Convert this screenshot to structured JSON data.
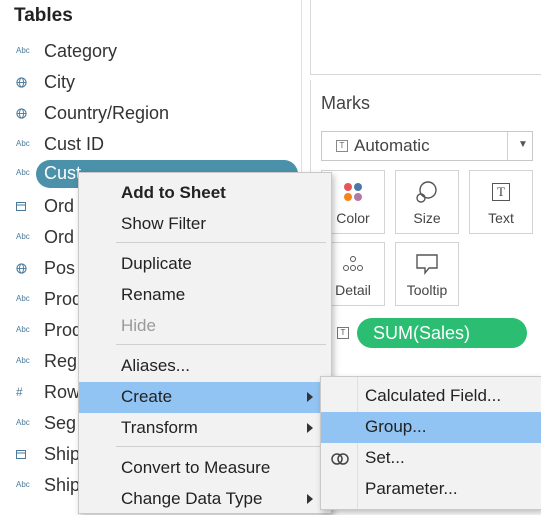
{
  "data_pane": {
    "title": "Tables",
    "fields": [
      {
        "label": "Category",
        "icon": "abc-icon",
        "type_text": "Abc"
      },
      {
        "label": "City",
        "icon": "globe-icon"
      },
      {
        "label": "Country/Region",
        "icon": "globe-icon"
      },
      {
        "label": "Cust ID",
        "icon": "abc-icon",
        "type_text": "Abc"
      },
      {
        "label": "Customer Name",
        "visible_label": "Cust",
        "icon": "abc-icon",
        "type_text": "Abc",
        "selected": true
      },
      {
        "label": "Ord",
        "icon": "calendar-icon"
      },
      {
        "label": "Ord",
        "icon": "abc-icon",
        "type_text": "Abc"
      },
      {
        "label": "Pos",
        "icon": "globe-icon"
      },
      {
        "label": "Prod",
        "icon": "abc-icon",
        "type_text": "Abc"
      },
      {
        "label": "Prod",
        "icon": "abc-icon",
        "type_text": "Abc"
      },
      {
        "label": "Reg",
        "icon": "abc-icon",
        "type_text": "Abc"
      },
      {
        "label": "Row",
        "icon": "hash-icon",
        "type_text": "#"
      },
      {
        "label": "Seg",
        "icon": "abc-icon",
        "type_text": "Abc"
      },
      {
        "label": "Ship",
        "icon": "calendar-icon"
      },
      {
        "label": "Ship",
        "icon": "abc-icon",
        "type_text": "Abc"
      }
    ]
  },
  "marks": {
    "title": "Marks",
    "mark_type": "Automatic",
    "mark_type_icon_text": "T",
    "cards": [
      {
        "label": "Color",
        "icon": "color-icon"
      },
      {
        "label": "Size",
        "icon": "size-icon"
      },
      {
        "label": "Text",
        "icon": "text-icon",
        "icon_text": "T"
      },
      {
        "label": "Detail",
        "icon": "detail-icon"
      },
      {
        "label": "Tooltip",
        "icon": "tooltip-icon"
      }
    ],
    "pill_icon_text": "T",
    "pill": "SUM(Sales)",
    "pill_color": "#2bbd71"
  },
  "context_menu": {
    "items": [
      {
        "label": "Add to Sheet",
        "bold": true
      },
      {
        "label": "Show Filter"
      },
      {
        "label": "Duplicate"
      },
      {
        "label": "Rename"
      },
      {
        "label": "Hide",
        "disabled": true
      },
      {
        "label": "Aliases..."
      },
      {
        "label": "Create",
        "submenu": true,
        "highlighted": true
      },
      {
        "label": "Transform",
        "submenu": true
      },
      {
        "label": "Convert to Measure"
      },
      {
        "label": "Change Data Type",
        "submenu": true
      }
    ],
    "highlight_color": "#91c4f2"
  },
  "create_submenu": {
    "items": [
      {
        "label": "Calculated Field..."
      },
      {
        "label": "Group...",
        "highlighted": true
      },
      {
        "label": "Set...",
        "icon": "set-icon"
      },
      {
        "label": "Parameter..."
      }
    ]
  },
  "colors": {
    "selected_field": "#4a91a9",
    "menu_bg": "#f2f2f2"
  }
}
